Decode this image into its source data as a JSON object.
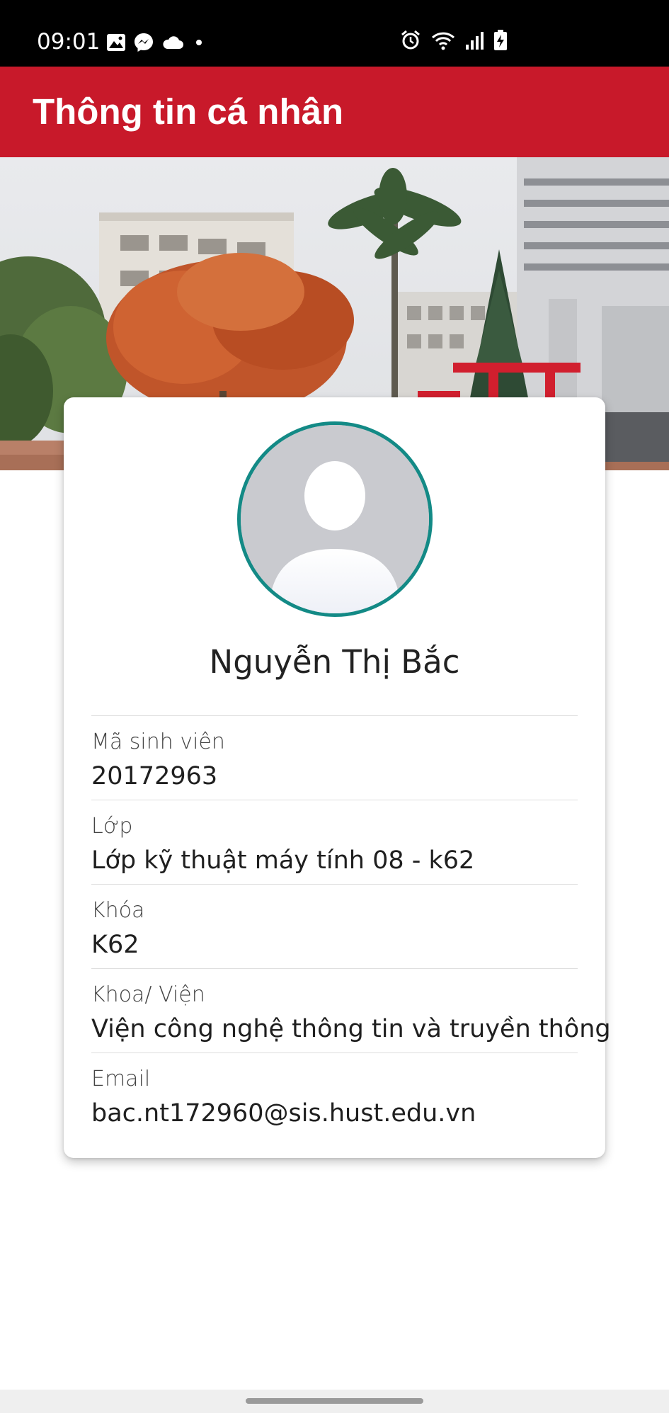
{
  "status_bar": {
    "time": "09:01",
    "left_icons": [
      "gallery-icon",
      "messenger-icon",
      "cloud-icon",
      "dot-icon"
    ],
    "right_icons": [
      "alarm-icon",
      "wifi-icon",
      "signal-icon",
      "battery-charging-icon"
    ]
  },
  "app_bar": {
    "title": "Thông tin cá nhân",
    "color": "#c8192a"
  },
  "hero": {
    "image": "campus-banner"
  },
  "profile": {
    "name": "Nguyễn Thị Bắc",
    "avatar_border_color": "#138a86",
    "fields": [
      {
        "label": "Mã sinh viên",
        "value": "20172963"
      },
      {
        "label": "Lớp",
        "value": "Lớp kỹ thuật máy tính 08 - k62"
      },
      {
        "label": "Khóa",
        "value": "K62"
      },
      {
        "label": "Khoa/ Viện",
        "value": "Viện công nghệ thông tin và truyền thông"
      },
      {
        "label": "Email",
        "value": "bac.nt172960@sis.hust.edu.vn"
      }
    ]
  }
}
